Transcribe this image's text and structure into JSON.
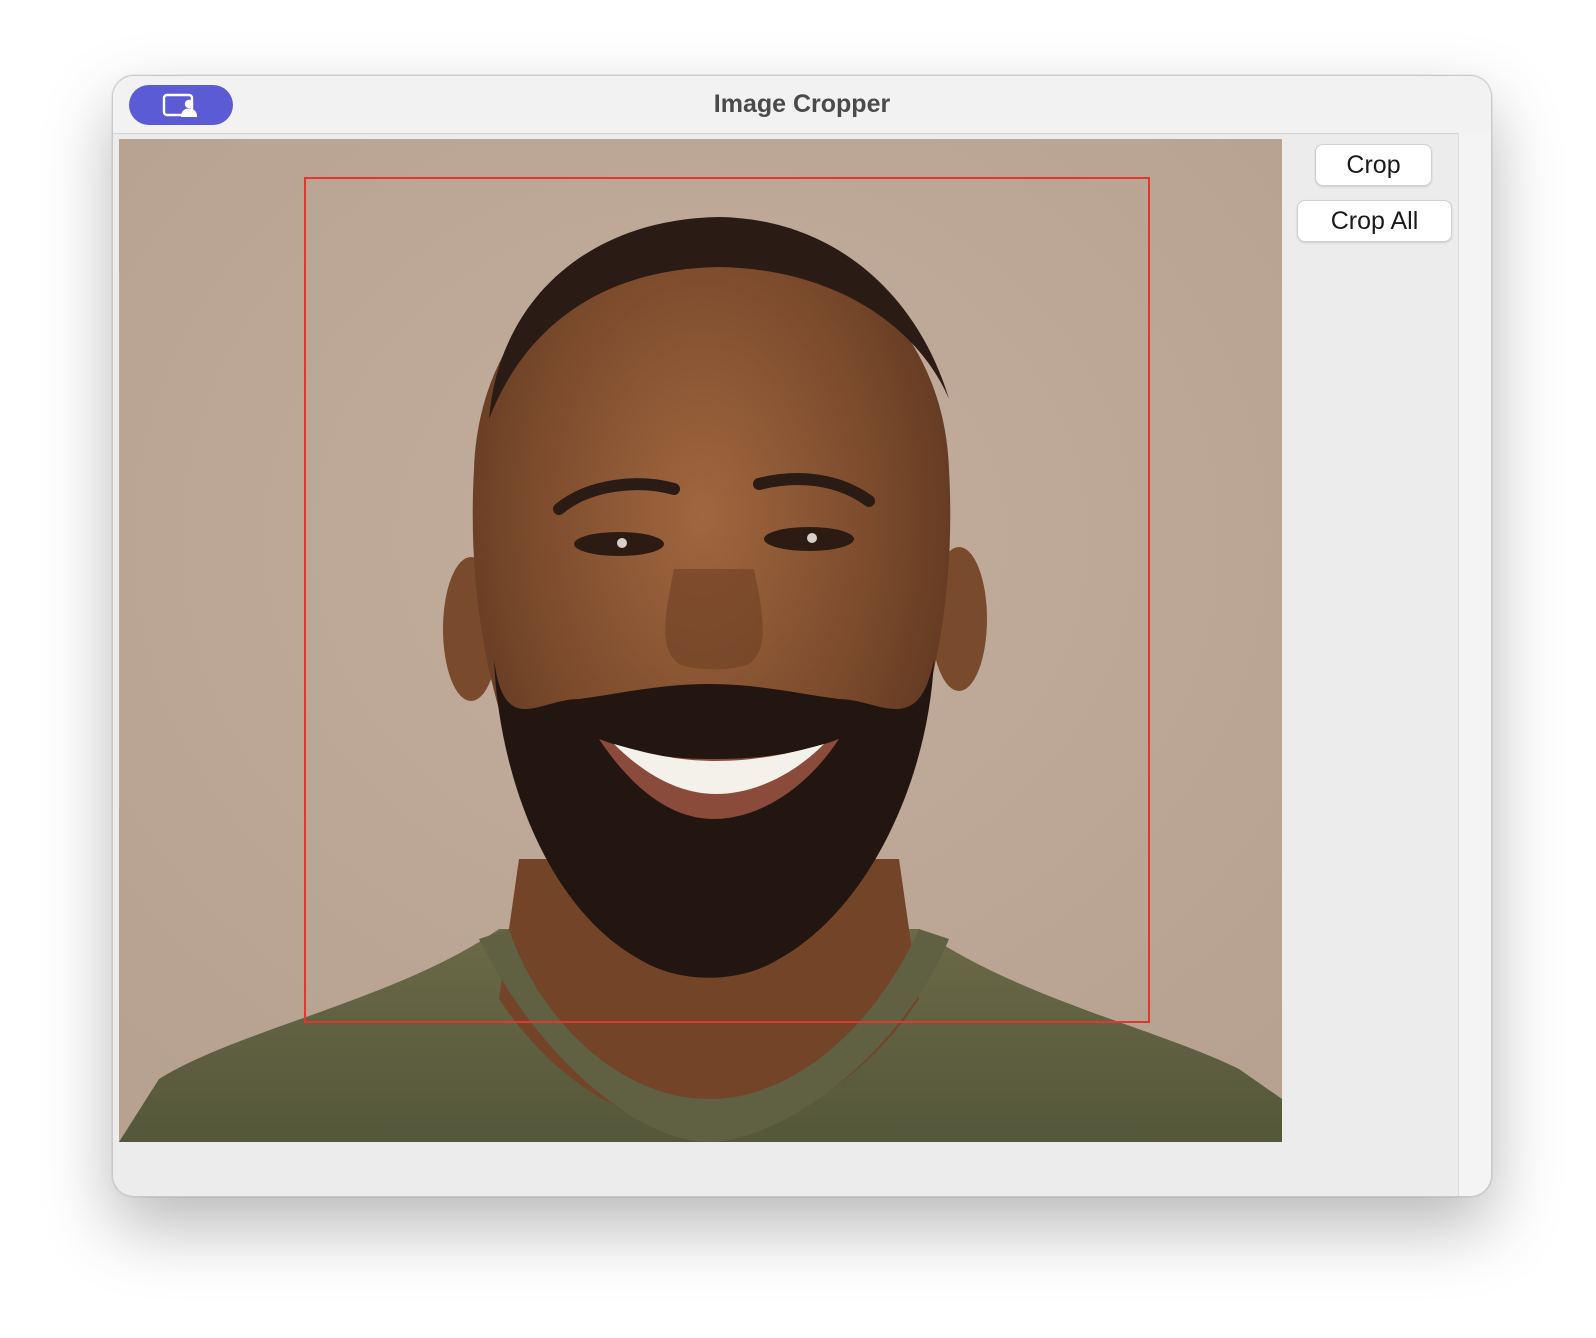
{
  "window": {
    "title": "Image Cropper"
  },
  "toolbar": {
    "app_icon": "photo-person-icon",
    "accent_color": "#5b5bd6"
  },
  "canvas": {
    "image_description_icon": "portrait-photo",
    "crop_rect_color": "#e0382e"
  },
  "buttons": {
    "crop_label": "Crop",
    "crop_all_label": "Crop All"
  }
}
